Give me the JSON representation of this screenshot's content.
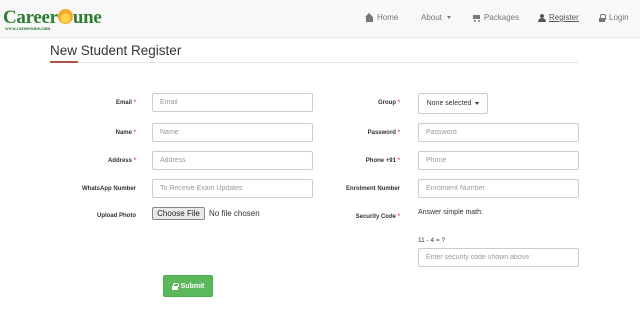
{
  "brand": {
    "name_part1": "Career",
    "name_part2": "une",
    "url": "www.careersune.com"
  },
  "nav": {
    "home": "Home",
    "about": "About",
    "packages": "Packages",
    "register": "Register",
    "login": "Login"
  },
  "page": {
    "title": "New Student Register"
  },
  "form": {
    "email": {
      "label": "Email",
      "placeholder": "Email"
    },
    "name": {
      "label": "Name",
      "placeholder": "Name"
    },
    "address": {
      "label": "Address",
      "placeholder": "Address"
    },
    "whatsapp": {
      "label": "WhatsApp Number",
      "placeholder": "To Receive Exam Updates"
    },
    "photo": {
      "label": "Upload Photo",
      "button": "Choose File",
      "status": "No file chosen"
    },
    "group": {
      "label": "Group",
      "value": "None selected"
    },
    "password": {
      "label": "Password",
      "placeholder": "Password"
    },
    "phone": {
      "label": "Phone +91",
      "placeholder": "Phone"
    },
    "enrolment": {
      "label": "Enrolment Number",
      "placeholder": "Enrolment Number"
    },
    "security": {
      "label": "Security Code",
      "prompt": "Answer simple math:",
      "question": "11 - 4 = ?",
      "placeholder": "Enter security code shown above"
    },
    "required_mark": "*",
    "submit": "Submit"
  },
  "colors": {
    "brand_green": "#2e7d32",
    "submit_green": "#5cb85c",
    "required_red": "#d9534f",
    "title_accent": "#b5533c"
  },
  "icons": {
    "home": "home-icon",
    "about": "caret-down-icon",
    "packages": "cart-icon",
    "register": "user-icon",
    "login": "lock-icon",
    "submit": "lock-icon"
  }
}
